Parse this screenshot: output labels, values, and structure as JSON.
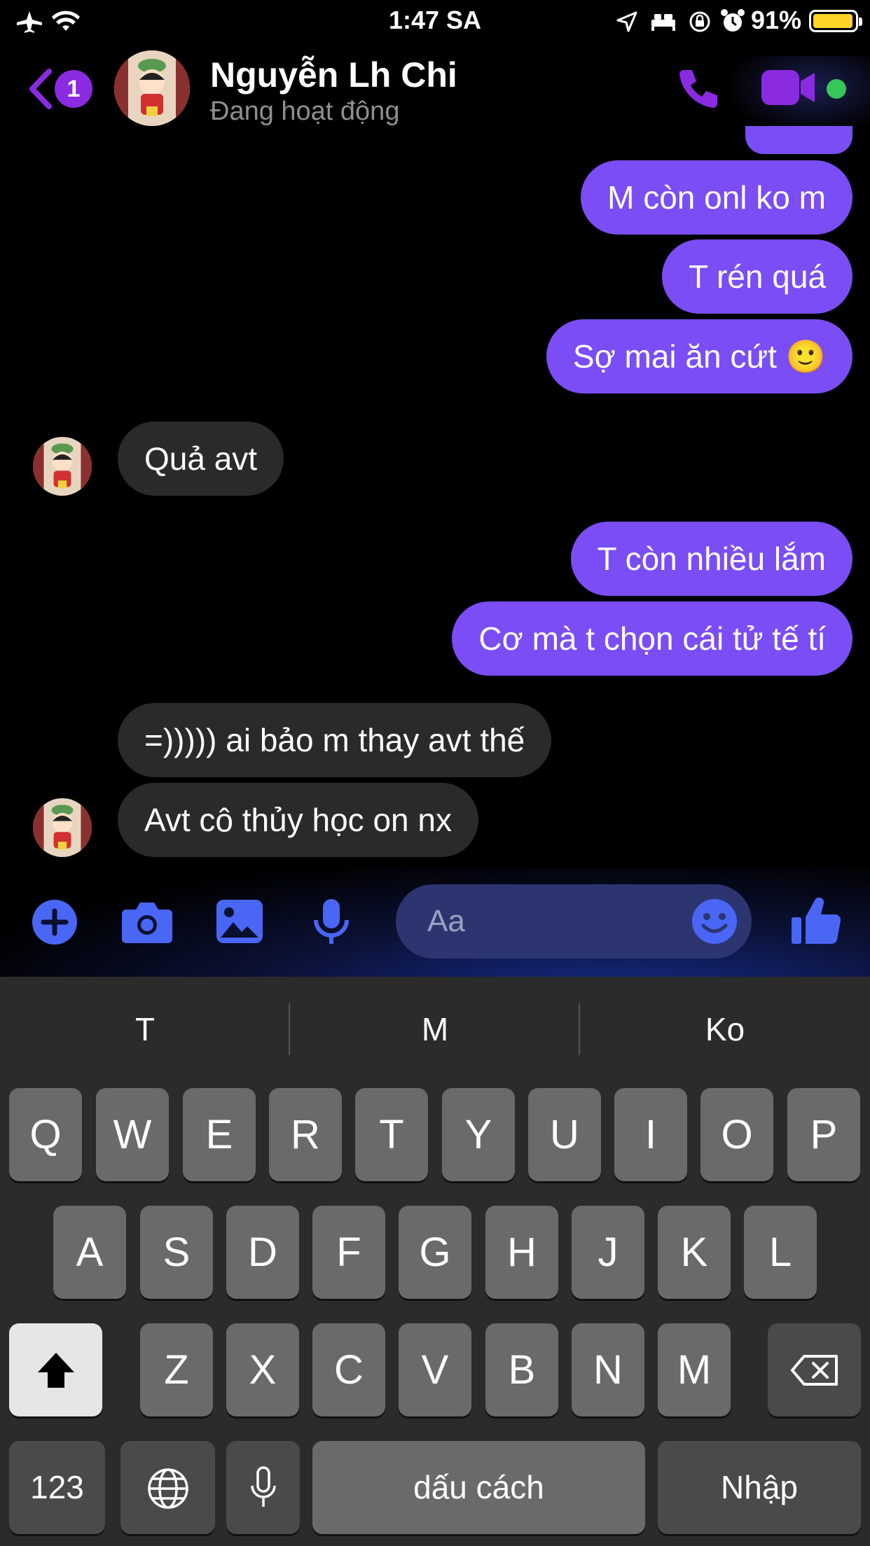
{
  "status_bar": {
    "time": "1:47 SA",
    "battery": "91%"
  },
  "header": {
    "back_count": "1",
    "contact_name": "Nguyễn Lh Chi",
    "contact_status": "Đang hoạt động"
  },
  "messages": [
    {
      "side": "out",
      "text": "M còn onl ko m"
    },
    {
      "side": "out",
      "text": "T rén quá"
    },
    {
      "side": "out",
      "text": "Sợ mai ăn cứt 🙂"
    },
    {
      "side": "in",
      "text": "Quả avt"
    },
    {
      "side": "out",
      "text": "T còn nhiều lắm"
    },
    {
      "side": "out",
      "text": "Cơ mà t chọn cái tử tế tí"
    },
    {
      "side": "in",
      "text": "=))))) ai bảo m thay avt thế"
    },
    {
      "side": "in",
      "text": "Avt cô thủy học on nx"
    }
  ],
  "composer": {
    "placeholder": "Aa"
  },
  "keyboard": {
    "suggestions": [
      "T",
      "M",
      "Ko"
    ],
    "row1": [
      "Q",
      "W",
      "E",
      "R",
      "T",
      "Y",
      "U",
      "I",
      "O",
      "P"
    ],
    "row2": [
      "A",
      "S",
      "D",
      "F",
      "G",
      "H",
      "J",
      "K",
      "L"
    ],
    "row3": [
      "Z",
      "X",
      "C",
      "V",
      "B",
      "N",
      "M"
    ],
    "numbers_key": "123",
    "space_key": "dấu cách",
    "return_key": "Nhập"
  },
  "colors": {
    "outgoing_bubble": "#7a4df5",
    "incoming_bubble": "#2a2a2c",
    "accent": "#8a2be2",
    "online_dot": "#34c759"
  }
}
